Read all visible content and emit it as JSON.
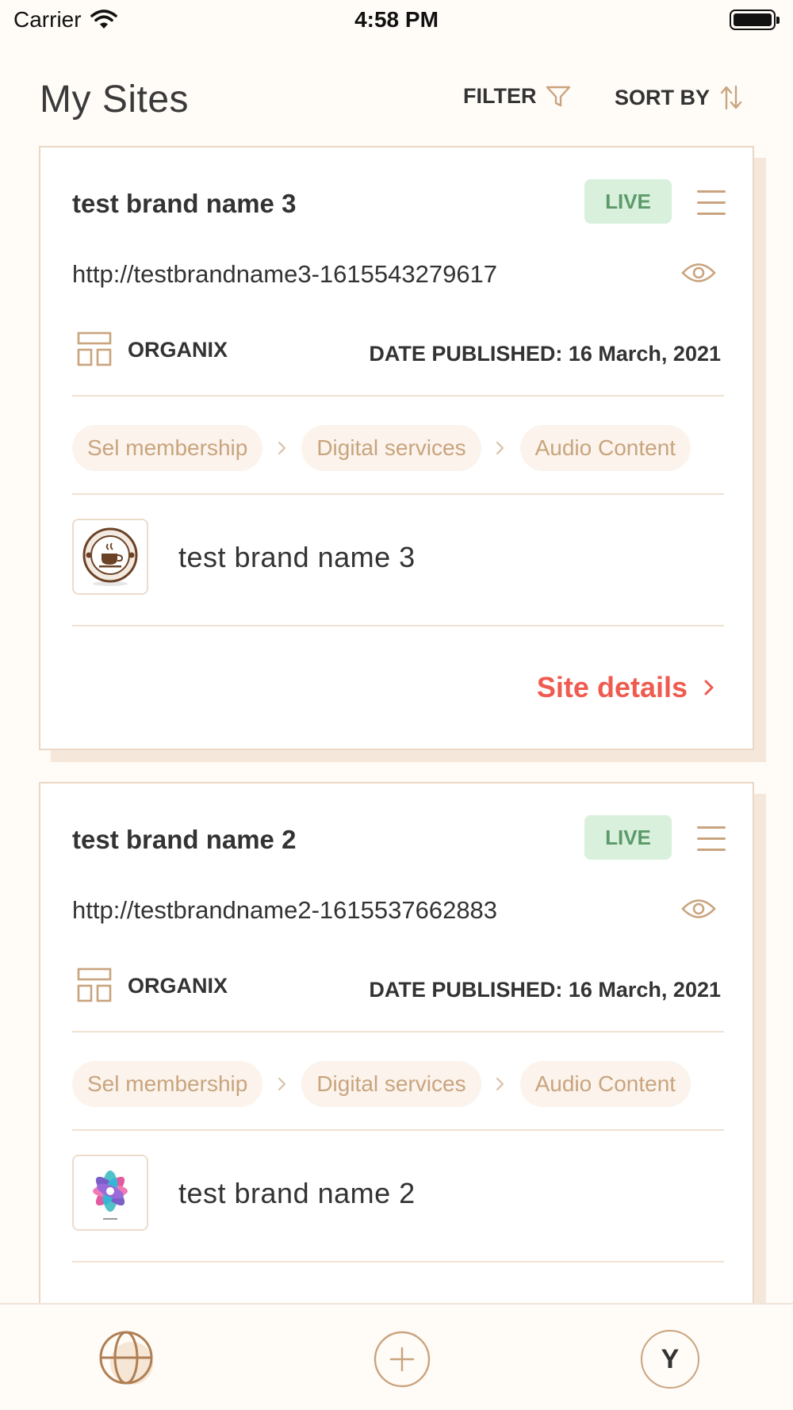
{
  "status_bar": {
    "carrier": "Carrier",
    "time": "4:58 PM"
  },
  "header": {
    "title": "My Sites",
    "filter_label": "FILTER",
    "sort_label": "SORT BY"
  },
  "sites": [
    {
      "title": "test brand name 3",
      "status": "LIVE",
      "url": "http://testbrandname3-1615543279617",
      "template": "ORGANIX",
      "date_published": "DATE PUBLISHED: 16 March, 2021",
      "categories": [
        "Sel membership",
        "Digital services",
        "Audio Content"
      ],
      "brand_name": "test brand name 3",
      "details_label": "Site details"
    },
    {
      "title": "test brand name 2",
      "status": "LIVE",
      "url": "http://testbrandname2-1615537662883",
      "template": "ORGANIX",
      "date_published": "DATE PUBLISHED: 16 March, 2021",
      "categories": [
        "Sel membership",
        "Digital services",
        "Audio Content"
      ],
      "brand_name": "test brand name 2"
    }
  ],
  "tab_bar": {
    "items": [
      {
        "icon": "globe-icon",
        "active": true
      },
      {
        "icon": "plus-circle-icon"
      },
      {
        "icon": "avatar",
        "initial": "Y"
      }
    ]
  },
  "colors": {
    "accent": "#c9a47e",
    "live_bg": "#d8f0dc",
    "live_text": "#5c9a6a",
    "link": "#ef5b4f",
    "background": "#fffbf7"
  }
}
